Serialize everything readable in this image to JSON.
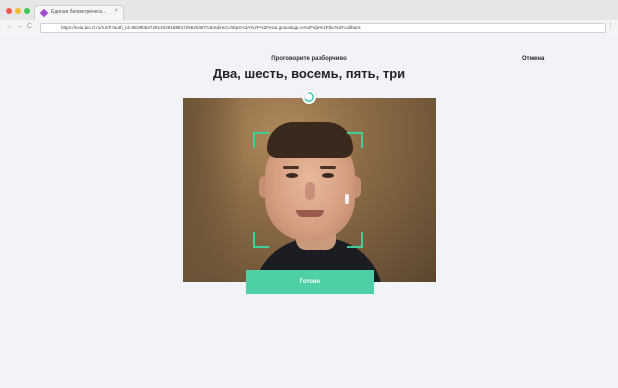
{
  "browser": {
    "tab_title": "Единая биометрическ...",
    "tab_close": "×",
    "url": "https://esia.bio.rt.ru/ru/rt/?auth_id=8E390547291342918854726620487C&redirect=https%3A%2F%2Fesia.gosuslugi.ru%2Fidp%2Fbio%2Fcallback",
    "back": "←",
    "forward": "→",
    "reload": "C",
    "menu": "⋮",
    "colors": {
      "close": "#f25b55",
      "minimize": "#f5bd37",
      "maximize": "#3fc950"
    }
  },
  "page": {
    "hint": "Проговорите разборчиво",
    "phrase": "Два, шесть, восемь, пять, три",
    "cancel_label": "Отмена",
    "ready_label": "Готово",
    "accent_color": "#4ecfa5",
    "progress_value": 0.65
  }
}
